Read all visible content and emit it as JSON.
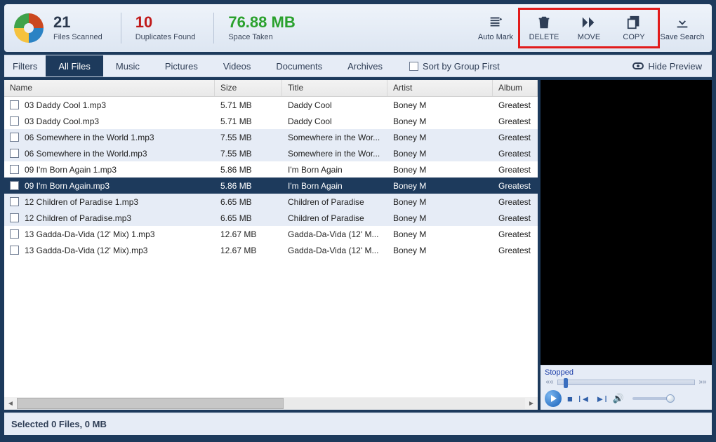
{
  "stats": {
    "scanned_num": "21",
    "scanned_label": "Files Scanned",
    "dup_num": "10",
    "dup_label": "Duplicates Found",
    "space_num": "76.88 MB",
    "space_label": "Space Taken"
  },
  "actions": {
    "automark": "Auto Mark",
    "delete": "DELETE",
    "move": "MOVE",
    "copy": "COPY",
    "save": "Save Search"
  },
  "filters": {
    "label": "Filters",
    "tabs": [
      "All Files",
      "Music",
      "Pictures",
      "Videos",
      "Documents",
      "Archives"
    ],
    "sort_label": "Sort by Group First",
    "hide_preview": "Hide Preview"
  },
  "columns": {
    "name": "Name",
    "size": "Size",
    "title": "Title",
    "artist": "Artist",
    "album": "Album"
  },
  "rows": [
    {
      "name": "03 Daddy Cool 1.mp3",
      "size": "5.71 MB",
      "title": "Daddy Cool",
      "artist": "Boney M",
      "album": "Greatest",
      "zebra": false,
      "sel": false
    },
    {
      "name": "03 Daddy Cool.mp3",
      "size": "5.71 MB",
      "title": "Daddy Cool",
      "artist": "Boney M",
      "album": "Greatest",
      "zebra": false,
      "sel": false
    },
    {
      "name": "06 Somewhere in the World 1.mp3",
      "size": "7.55 MB",
      "title": "Somewhere in the Wor...",
      "artist": "Boney M",
      "album": "Greatest",
      "zebra": true,
      "sel": false
    },
    {
      "name": "06 Somewhere in the World.mp3",
      "size": "7.55 MB",
      "title": "Somewhere in the Wor...",
      "artist": "Boney M",
      "album": "Greatest",
      "zebra": true,
      "sel": false
    },
    {
      "name": "09 I'm Born Again 1.mp3",
      "size": "5.86 MB",
      "title": "I'm Born Again",
      "artist": "Boney M",
      "album": "Greatest",
      "zebra": false,
      "sel": false
    },
    {
      "name": "09 I'm Born Again.mp3",
      "size": "5.86 MB",
      "title": "I'm Born Again",
      "artist": "Boney M",
      "album": "Greatest",
      "zebra": false,
      "sel": true
    },
    {
      "name": "12 Children of Paradise 1.mp3",
      "size": "6.65 MB",
      "title": "Children of Paradise",
      "artist": "Boney M",
      "album": "Greatest",
      "zebra": true,
      "sel": false
    },
    {
      "name": "12 Children of Paradise.mp3",
      "size": "6.65 MB",
      "title": "Children of Paradise",
      "artist": "Boney M",
      "album": "Greatest",
      "zebra": true,
      "sel": false
    },
    {
      "name": "13 Gadda-Da-Vida (12' Mix) 1.mp3",
      "size": "12.67 MB",
      "title": "Gadda-Da-Vida (12' M...",
      "artist": "Boney M",
      "album": "Greatest",
      "zebra": false,
      "sel": false
    },
    {
      "name": "13 Gadda-Da-Vida (12' Mix).mp3",
      "size": "12.67 MB",
      "title": "Gadda-Da-Vida (12' M...",
      "artist": "Boney M",
      "album": "Greatest",
      "zebra": false,
      "sel": false
    }
  ],
  "player": {
    "status": "Stopped"
  },
  "status_bar": "Selected 0 Files, 0 MB"
}
